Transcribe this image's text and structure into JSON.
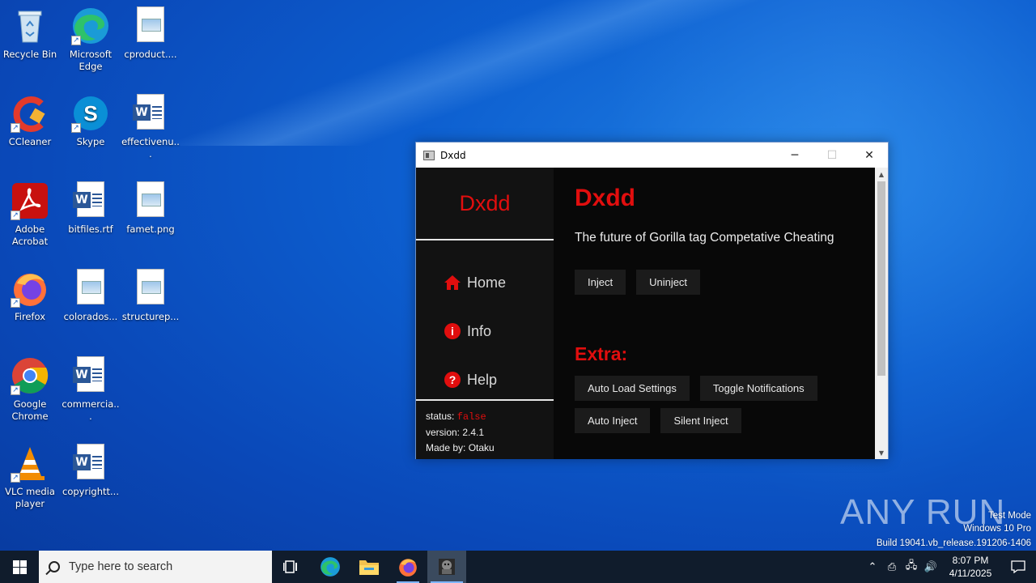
{
  "desktop": {
    "icons": [
      {
        "label": "Recycle Bin"
      },
      {
        "label": "Microsoft Edge"
      },
      {
        "label": "cproduct...."
      },
      {
        "label": "CCleaner"
      },
      {
        "label": "Skype"
      },
      {
        "label": "effectivenu..."
      },
      {
        "label": "Adobe Acrobat"
      },
      {
        "label": "bitfiles.rtf"
      },
      {
        "label": "famet.png"
      },
      {
        "label": "Firefox"
      },
      {
        "label": "colorados..."
      },
      {
        "label": "structurep..."
      },
      {
        "label": "Google Chrome"
      },
      {
        "label": "commercia..."
      },
      {
        "label": "VLC media player"
      },
      {
        "label": "copyrightt..."
      }
    ]
  },
  "window": {
    "title": "Dxdd",
    "controls": {
      "minimize": "─",
      "maximize": "☐",
      "close": "✕"
    },
    "sidebar": {
      "brand": "Dxdd",
      "nav": [
        {
          "label": "Home",
          "icon": "home-icon"
        },
        {
          "label": "Info",
          "icon": "info-icon"
        },
        {
          "label": "Help",
          "icon": "help-icon"
        }
      ],
      "status_label": "status:",
      "status_value": "false",
      "version": "version: 2.4.1",
      "author": "Made by: Otaku"
    },
    "main": {
      "heading": "Dxdd",
      "subtitle": "The future of Gorilla tag Competative Cheating",
      "buttons": [
        "Inject",
        "Uninject"
      ],
      "extra_heading": "Extra:",
      "extra_buttons": [
        "Auto Load Settings",
        "Toggle Notifications",
        "Auto Inject",
        "Silent Inject"
      ]
    }
  },
  "watermark": {
    "logo": "ANY RUN",
    "test_mode": "Test Mode",
    "edition": "Windows 10 Pro",
    "build": "Build 19041.vb_release.191206-1406"
  },
  "taskbar": {
    "search_placeholder": "Type here to search",
    "time": "8:07 PM",
    "date": "4/11/2025"
  },
  "colors": {
    "accent_red": "#e10e0e",
    "app_bg": "#080808",
    "sidebar_bg": "#121212",
    "taskbar_bg": "#101c2c"
  }
}
